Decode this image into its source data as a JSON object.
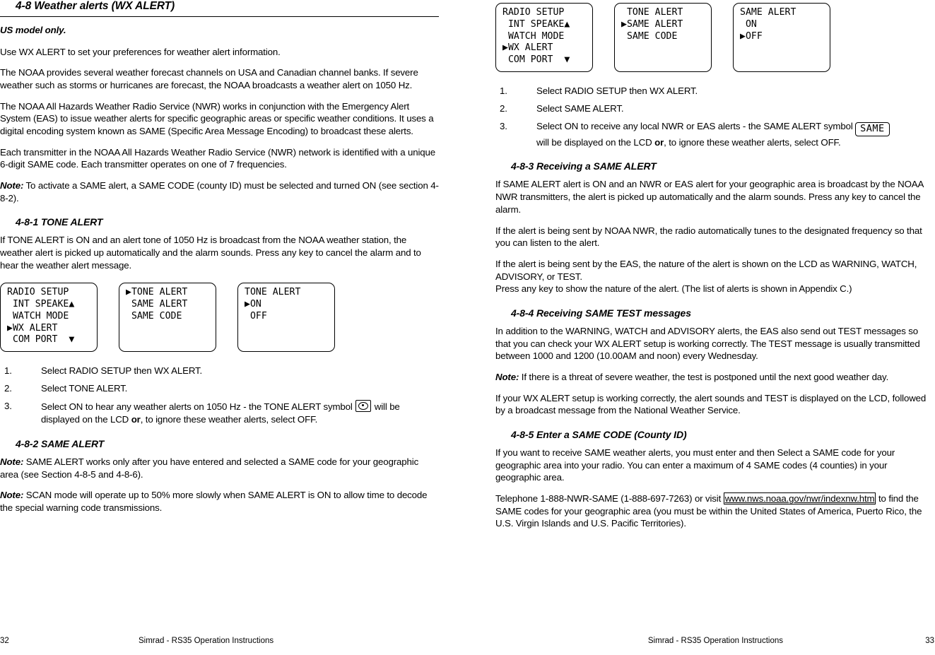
{
  "left": {
    "title": "4-8 Weather alerts (WX ALERT)",
    "us_model": "US model only.",
    "p1": "Use WX ALERT to set your preferences for weather alert information.",
    "p2": "The NOAA provides several weather forecast channels on USA and Canadian channel banks. If severe weather such as storms or hurricanes are forecast, the NOAA broadcasts a weather alert on 1050 Hz.",
    "p3": "The NOAA All Hazards Weather Radio Service (NWR) works in conjunction with the Emergency Alert System (EAS) to issue weather alerts for specific geographic areas or specific weather conditions. It uses a digital encoding system known as SAME (Specific Area Message Encoding) to broadcast these alerts.",
    "p4": "Each transmitter in the NOAA All Hazards Weather Radio Service (NWR) network is identified with a unique 6-digit SAME code. Each transmitter operates on one of 7 frequencies.",
    "note1_label": "Note:",
    "note1_text": " To activate a SAME alert, a SAME CODE (county ID) must be selected and turned ON (see section 4-8-2).",
    "sub1_title": "4-8-1 TONE ALERT",
    "p5": "If TONE ALERT is ON and an alert tone of 1050 Hz is broadcast from the NOAA weather station, the weather alert is picked up automatically and the alarm sounds. Press any key to cancel the alarm and to hear the weather alert message.",
    "lcd1": "RADIO SETUP\n INT SPEAKE▲\n WATCH MODE\n▶WX ALERT\n COM PORT  ▼",
    "lcd2": "▶TONE ALERT\n SAME ALERT\n SAME CODE",
    "lcd3": "TONE ALERT\n▶ON\n OFF",
    "step1_num": "1.",
    "step1": "Select RADIO SETUP then WX ALERT.",
    "step2_num": "2.",
    "step2": "Select TONE ALERT.",
    "step3_num": "3.",
    "step3_a": "Select ON to hear any weather alerts on 1050 Hz - the TONE ALERT symbol ",
    "step3_b": " will be displayed on the LCD ",
    "step3_or": "or",
    "step3_c": ", to ignore these weather alerts, select OFF.",
    "sub2_title": "4-8-2 SAME ALERT",
    "note2_label": "Note:",
    "note2_text": " SAME ALERT works only after you have entered and selected a SAME code for your geographic area (see Section 4-8-5 and 4-8-6).",
    "note3_label": "Note:",
    "note3_text": " SCAN mode will operate up to 50% more slowly when SAME ALERT is ON to allow time to decode the special warning code transmissions.",
    "footer_page": "32",
    "footer_text": "Simrad - RS35 Operation Instructions"
  },
  "right": {
    "lcd1": "RADIO SETUP\n INT SPEAKE▲\n WATCH MODE\n▶WX ALERT\n COM PORT  ▼",
    "lcd2": " TONE ALERT\n▶SAME ALERT\n SAME CODE",
    "lcd3": "SAME ALERT\n ON\n▶OFF",
    "step1_num": "1.",
    "step1": "Select RADIO SETUP then WX ALERT.",
    "step2_num": "2.",
    "step2": "Select SAME ALERT.",
    "step3_num": "3.",
    "step3_a": "Select ON to receive any local NWR or EAS alerts - the SAME ALERT symbol ",
    "step3_badge": "SAME",
    "step3_b": "will be displayed on the LCD ",
    "step3_or": "or",
    "step3_c": ", to ignore these weather alerts, select OFF.",
    "sub3_title": "4-8-3 Receiving a SAME ALERT",
    "p1": "If SAME ALERT alert is ON and an NWR or EAS alert for your geographic area is broadcast by the NOAA NWR transmitters, the alert is picked up automatically and the alarm sounds. Press any key to cancel the alarm.",
    "p2": "If the alert is being sent by NOAA NWR, the radio automatically tunes to the designated frequency so that you can listen to the alert.",
    "p3": "If the alert is being sent by the EAS, the nature of the alert is shown on the LCD as WARNING, WATCH, ADVISORY, or TEST.\nPress any key to show the nature of the alert. (The list of alerts is shown in Appendix C.)",
    "sub4_title": "4-8-4 Receiving SAME TEST messages",
    "p4": "In addition to the WARNING, WATCH and ADVISORY alerts, the EAS also send out TEST messages so that you can check your WX ALERT setup is working correctly. The TEST message is usually transmitted between 1000 and 1200 (10.00AM and noon) every Wednesday.",
    "note1_label": "Note:",
    "note1_text": " If there is a threat of severe weather, the test is postponed until the next good weather day.",
    "p5": "If your WX ALERT setup is working correctly, the alert sounds and TEST is displayed on the LCD, followed by a broadcast message from the National Weather Service.",
    "sub5_title": "4-8-5 Enter a SAME CODE (County ID)",
    "p6": "If you want to receive SAME weather alerts, you must enter and then Select a SAME code for your geographic area into your radio. You can enter a maximum of 4 SAME codes (4 counties) in your geographic area.",
    "p7_a": "Telephone 1-888-NWR-SAME (1-888-697-7263) or visit ",
    "p7_link": "www.nws.noaa.gov/nwr/indexnw.htm",
    "p7_b": " to find the SAME codes for your geographic area (you must be within the United States of America, Puerto Rico, the U.S. Virgin Islands and U.S. Pacific Territories).",
    "footer_page": "33",
    "footer_text": "Simrad - RS35 Operation Instructions"
  }
}
